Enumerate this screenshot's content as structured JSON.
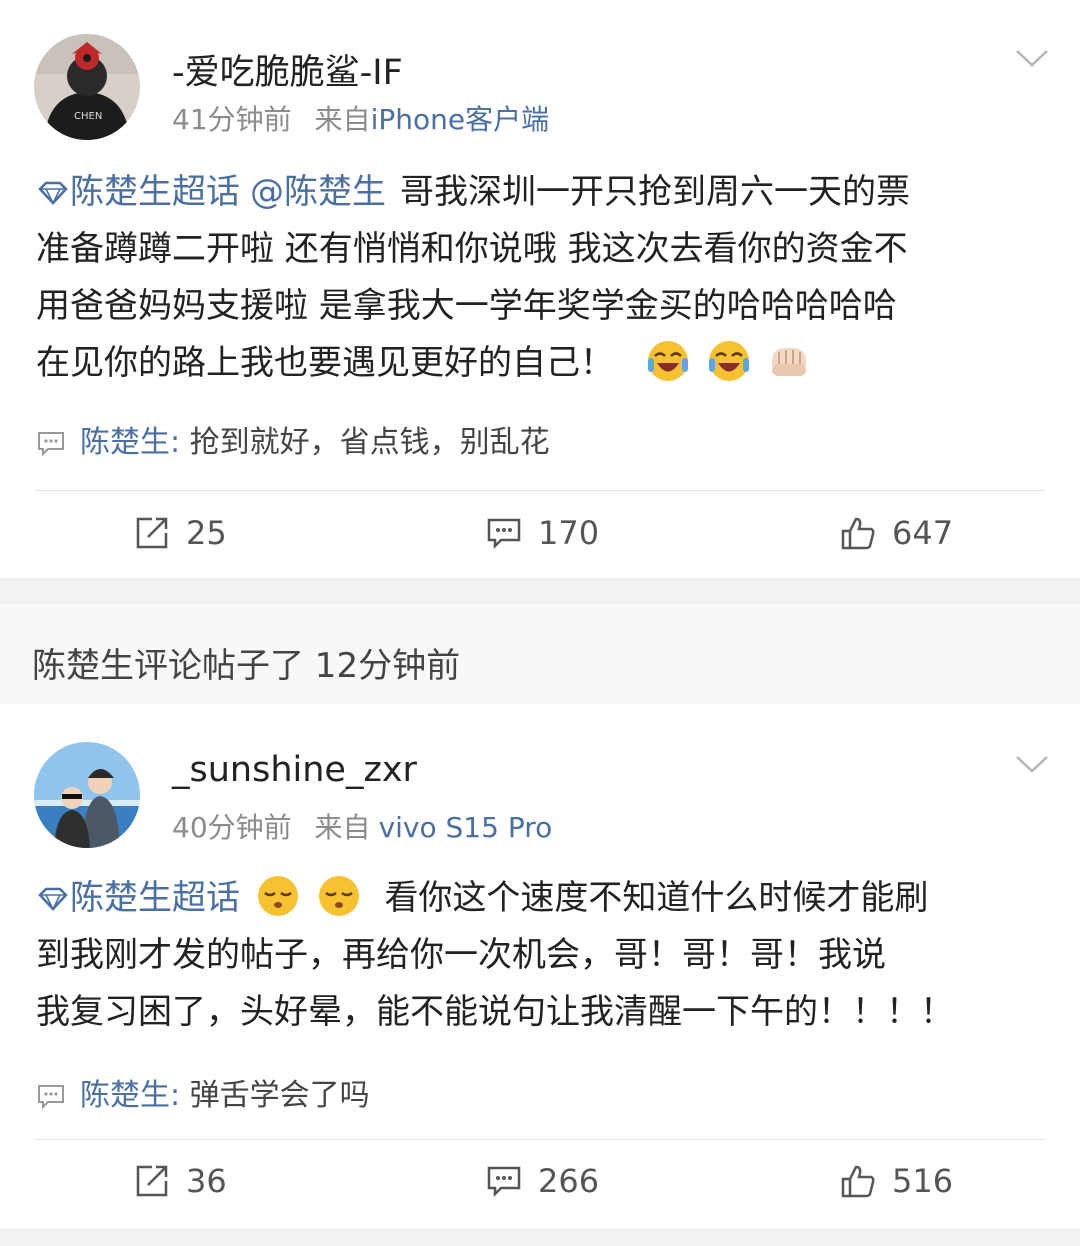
{
  "posts": [
    {
      "username": "-爱吃脆脆鲨-IF",
      "time": "41分钟前",
      "source_prefix": "来自",
      "source": "iPhone客户端",
      "supertopic": "陈楚生超话",
      "mention": "@陈楚生",
      "lines": [
        "哥我深圳一开只抢到周六一天的票",
        "准备蹲蹲二开啦 还有悄悄和你说哦 我这次去看你的资金不",
        "用爸爸妈妈支援啦 是拿我大一学年奖学金买的哈哈哈哈哈",
        "在见你的路上我也要遇见更好的自己！"
      ],
      "reply_user": "陈楚生:",
      "reply_text": " 抢到就好，省点钱，别乱花",
      "reposts": "25",
      "comments": "170",
      "likes": "647"
    },
    {
      "username": "_sunshine_zxr",
      "time": "40分钟前",
      "source_prefix": "来自",
      "source": "vivo S15 Pro",
      "supertopic": "陈楚生超话",
      "lines": [
        "看你这个速度不知道什么时候才能刷",
        "到我刚才发的帖子，再给你一次机会，哥！哥！哥！我说",
        "我复习困了，头好晕，能不能说句让我清醒一下午的！！！！"
      ],
      "reply_user": "陈楚生:",
      "reply_text": " 弹舌学会了吗",
      "reposts": "36",
      "comments": "266",
      "likes": "516"
    }
  ],
  "notice": "陈楚生评论帖子了 12分钟前",
  "colors": {
    "link": "#4a6fa5",
    "meta": "#8c8c8c",
    "separator": "#f2f2f2",
    "notice_bg": "#f8f8f8"
  },
  "icons": [
    "chevron-down-icon",
    "diamond-icon",
    "grinning-sweat-emoji",
    "punch-emoji",
    "relieved-emoji",
    "comment-icon",
    "repost-icon",
    "like-icon"
  ]
}
